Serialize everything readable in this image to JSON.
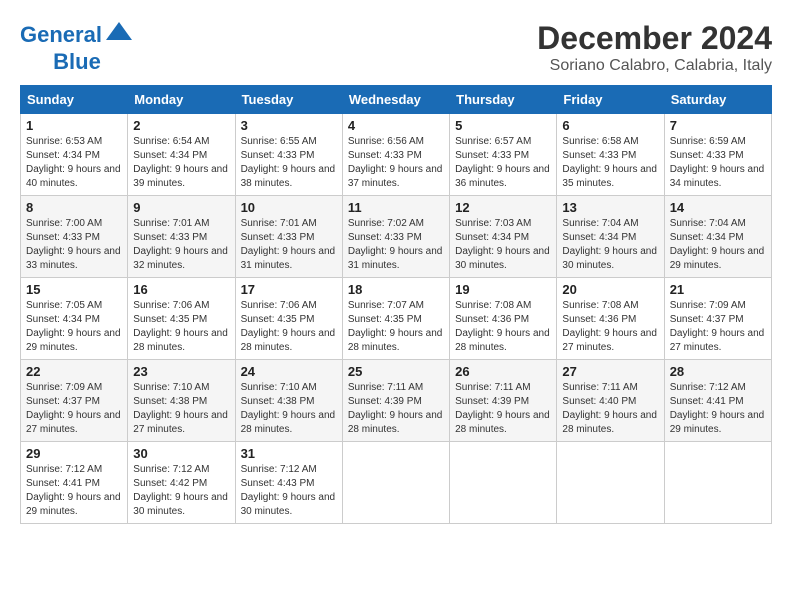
{
  "logo": {
    "line1": "General",
    "line2": "Blue"
  },
  "title": "December 2024",
  "location": "Soriano Calabro, Calabria, Italy",
  "days_of_week": [
    "Sunday",
    "Monday",
    "Tuesday",
    "Wednesday",
    "Thursday",
    "Friday",
    "Saturday"
  ],
  "weeks": [
    [
      {
        "day": "1",
        "sunrise": "6:53 AM",
        "sunset": "4:34 PM",
        "daylight": "9 hours and 40 minutes."
      },
      {
        "day": "2",
        "sunrise": "6:54 AM",
        "sunset": "4:34 PM",
        "daylight": "9 hours and 39 minutes."
      },
      {
        "day": "3",
        "sunrise": "6:55 AM",
        "sunset": "4:33 PM",
        "daylight": "9 hours and 38 minutes."
      },
      {
        "day": "4",
        "sunrise": "6:56 AM",
        "sunset": "4:33 PM",
        "daylight": "9 hours and 37 minutes."
      },
      {
        "day": "5",
        "sunrise": "6:57 AM",
        "sunset": "4:33 PM",
        "daylight": "9 hours and 36 minutes."
      },
      {
        "day": "6",
        "sunrise": "6:58 AM",
        "sunset": "4:33 PM",
        "daylight": "9 hours and 35 minutes."
      },
      {
        "day": "7",
        "sunrise": "6:59 AM",
        "sunset": "4:33 PM",
        "daylight": "9 hours and 34 minutes."
      }
    ],
    [
      {
        "day": "8",
        "sunrise": "7:00 AM",
        "sunset": "4:33 PM",
        "daylight": "9 hours and 33 minutes."
      },
      {
        "day": "9",
        "sunrise": "7:01 AM",
        "sunset": "4:33 PM",
        "daylight": "9 hours and 32 minutes."
      },
      {
        "day": "10",
        "sunrise": "7:01 AM",
        "sunset": "4:33 PM",
        "daylight": "9 hours and 31 minutes."
      },
      {
        "day": "11",
        "sunrise": "7:02 AM",
        "sunset": "4:33 PM",
        "daylight": "9 hours and 31 minutes."
      },
      {
        "day": "12",
        "sunrise": "7:03 AM",
        "sunset": "4:34 PM",
        "daylight": "9 hours and 30 minutes."
      },
      {
        "day": "13",
        "sunrise": "7:04 AM",
        "sunset": "4:34 PM",
        "daylight": "9 hours and 30 minutes."
      },
      {
        "day": "14",
        "sunrise": "7:04 AM",
        "sunset": "4:34 PM",
        "daylight": "9 hours and 29 minutes."
      }
    ],
    [
      {
        "day": "15",
        "sunrise": "7:05 AM",
        "sunset": "4:34 PM",
        "daylight": "9 hours and 29 minutes."
      },
      {
        "day": "16",
        "sunrise": "7:06 AM",
        "sunset": "4:35 PM",
        "daylight": "9 hours and 28 minutes."
      },
      {
        "day": "17",
        "sunrise": "7:06 AM",
        "sunset": "4:35 PM",
        "daylight": "9 hours and 28 minutes."
      },
      {
        "day": "18",
        "sunrise": "7:07 AM",
        "sunset": "4:35 PM",
        "daylight": "9 hours and 28 minutes."
      },
      {
        "day": "19",
        "sunrise": "7:08 AM",
        "sunset": "4:36 PM",
        "daylight": "9 hours and 28 minutes."
      },
      {
        "day": "20",
        "sunrise": "7:08 AM",
        "sunset": "4:36 PM",
        "daylight": "9 hours and 27 minutes."
      },
      {
        "day": "21",
        "sunrise": "7:09 AM",
        "sunset": "4:37 PM",
        "daylight": "9 hours and 27 minutes."
      }
    ],
    [
      {
        "day": "22",
        "sunrise": "7:09 AM",
        "sunset": "4:37 PM",
        "daylight": "9 hours and 27 minutes."
      },
      {
        "day": "23",
        "sunrise": "7:10 AM",
        "sunset": "4:38 PM",
        "daylight": "9 hours and 27 minutes."
      },
      {
        "day": "24",
        "sunrise": "7:10 AM",
        "sunset": "4:38 PM",
        "daylight": "9 hours and 28 minutes."
      },
      {
        "day": "25",
        "sunrise": "7:11 AM",
        "sunset": "4:39 PM",
        "daylight": "9 hours and 28 minutes."
      },
      {
        "day": "26",
        "sunrise": "7:11 AM",
        "sunset": "4:39 PM",
        "daylight": "9 hours and 28 minutes."
      },
      {
        "day": "27",
        "sunrise": "7:11 AM",
        "sunset": "4:40 PM",
        "daylight": "9 hours and 28 minutes."
      },
      {
        "day": "28",
        "sunrise": "7:12 AM",
        "sunset": "4:41 PM",
        "daylight": "9 hours and 29 minutes."
      }
    ],
    [
      {
        "day": "29",
        "sunrise": "7:12 AM",
        "sunset": "4:41 PM",
        "daylight": "9 hours and 29 minutes."
      },
      {
        "day": "30",
        "sunrise": "7:12 AM",
        "sunset": "4:42 PM",
        "daylight": "9 hours and 30 minutes."
      },
      {
        "day": "31",
        "sunrise": "7:12 AM",
        "sunset": "4:43 PM",
        "daylight": "9 hours and 30 minutes."
      },
      null,
      null,
      null,
      null
    ]
  ]
}
